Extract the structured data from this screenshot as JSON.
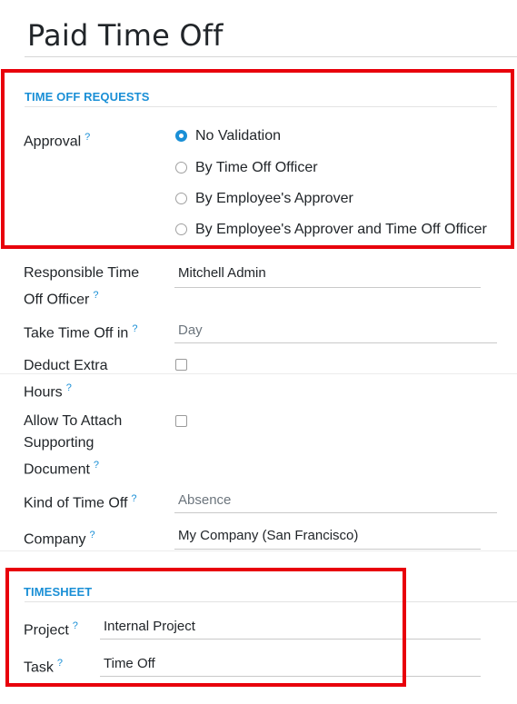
{
  "page": {
    "title": "Paid Time Off"
  },
  "time_off_requests": {
    "heading": "TIME OFF REQUESTS",
    "approval_label": "Approval",
    "approval_options": [
      "No Validation",
      "By Time Off Officer",
      "By Employee's Approver",
      "By Employee's Approver and Time Off Officer"
    ],
    "approval_selected": 0
  },
  "fields": {
    "responsible_label_1": "Responsible Time",
    "responsible_label_2": "Off Officer",
    "responsible_value": "Mitchell Admin",
    "take_time_off_label": "Take Time Off in",
    "take_time_off_value": "Day",
    "deduct_label_1": "Deduct Extra",
    "deduct_label_2": "Hours",
    "deduct_checked": false,
    "attach_label_1": "Allow To Attach",
    "attach_label_2": "Supporting",
    "attach_label_3": "Document",
    "attach_checked": false,
    "kind_label": "Kind of Time Off",
    "kind_value": "Absence",
    "company_label": "Company",
    "company_value": "My Company (San Francisco)"
  },
  "timesheet": {
    "heading": "TIMESHEET",
    "project_label": "Project",
    "project_value": "Internal Project",
    "task_label": "Task",
    "task_value": "Time Off"
  },
  "help_marker": "?",
  "colors": {
    "accent": "#1a8fd6",
    "highlight": "#e8000b"
  }
}
